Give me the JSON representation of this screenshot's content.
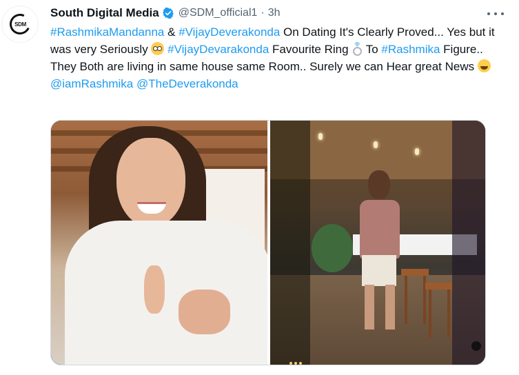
{
  "author": {
    "display_name": "South Digital Media",
    "handle": "@SDM_official1",
    "separator": "·",
    "time": "3h",
    "avatar_text": "SDM",
    "verified_color": "#1d9bf0"
  },
  "tweet": {
    "segments": [
      {
        "text": "#RashmikaMandanna",
        "type": "hashtag"
      },
      {
        "text": " & ",
        "type": "text"
      },
      {
        "text": "#VijayDeverakonda",
        "type": "hashtag"
      },
      {
        "text": " On Dating It's Clearly Proved... Yes but it was very Seriously ",
        "type": "text"
      },
      {
        "emoji": "flushed-face-emoji",
        "type": "emoji"
      },
      {
        "text": " ",
        "type": "text"
      },
      {
        "text": "#VijayDevarakonda",
        "type": "hashtag"
      },
      {
        "text": " Favourite Ring ",
        "type": "text"
      },
      {
        "emoji": "ring-emoji",
        "type": "emoji"
      },
      {
        "text": " To ",
        "type": "text"
      },
      {
        "text": "#Rashmika",
        "type": "hashtag"
      },
      {
        "text": " Figure.. They Both are living in same house same Room.. Surely we can Hear great News ",
        "type": "text"
      },
      {
        "emoji": "grinning-face-emoji",
        "type": "emoji"
      },
      {
        "text": " ",
        "type": "text"
      },
      {
        "text": "@iamRashmika",
        "type": "mention"
      },
      {
        "text": " ",
        "type": "text"
      },
      {
        "text": "@TheDeverakonda",
        "type": "mention"
      }
    ]
  },
  "media": {
    "images": [
      {
        "name": "woman-in-white-sweater-photo"
      },
      {
        "name": "man-standing-in-kitchen-photo"
      }
    ]
  },
  "colors": {
    "link": "#1d9bf0",
    "text": "#0f1419",
    "secondary": "#536471"
  },
  "icons": [
    "verified-badge-icon",
    "more-options-icon"
  ]
}
